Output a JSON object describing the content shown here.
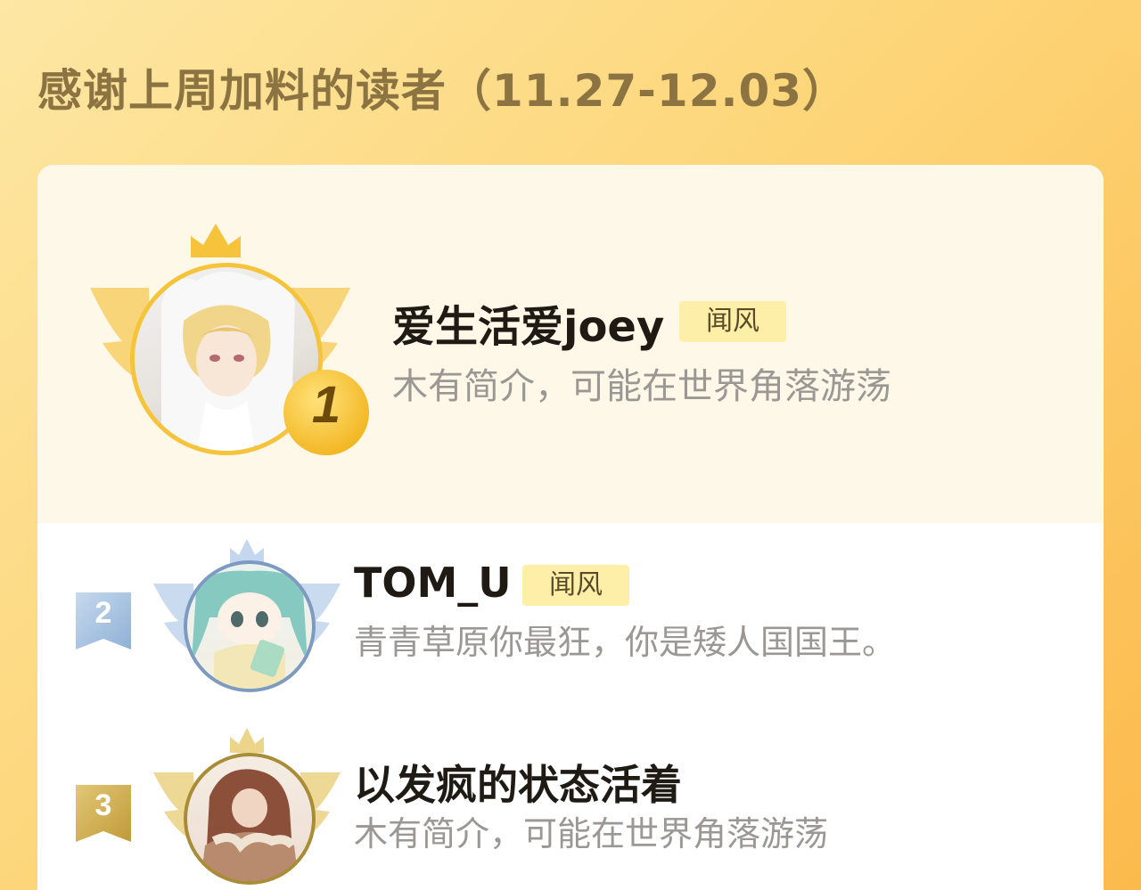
{
  "header": {
    "title": "感谢上周加料的读者（11.27-12.03）"
  },
  "leaderboard": [
    {
      "rank": "1",
      "name": "爱生活爱joey",
      "badge": "闻风",
      "bio": "木有简介，可能在世界角落游荡",
      "avatar": "avatar-anime-boy-white-hood"
    },
    {
      "rank": "2",
      "name": "TOM_U",
      "badge": "闻风",
      "bio": "青青草原你最狂，你是矮人国国王。",
      "avatar": "avatar-anime-girl-green-hair"
    },
    {
      "rank": "3",
      "name": "以发疯的状态活着",
      "badge": "",
      "bio": "木有简介，可能在世界角落游荡",
      "avatar": "avatar-anime-brown-hair-fur-coat"
    }
  ],
  "colors": {
    "gold": "#f5c43a",
    "silver": "#a9c3df",
    "bronze": "#cfa94a",
    "badge_bg": "#fdeea8"
  }
}
